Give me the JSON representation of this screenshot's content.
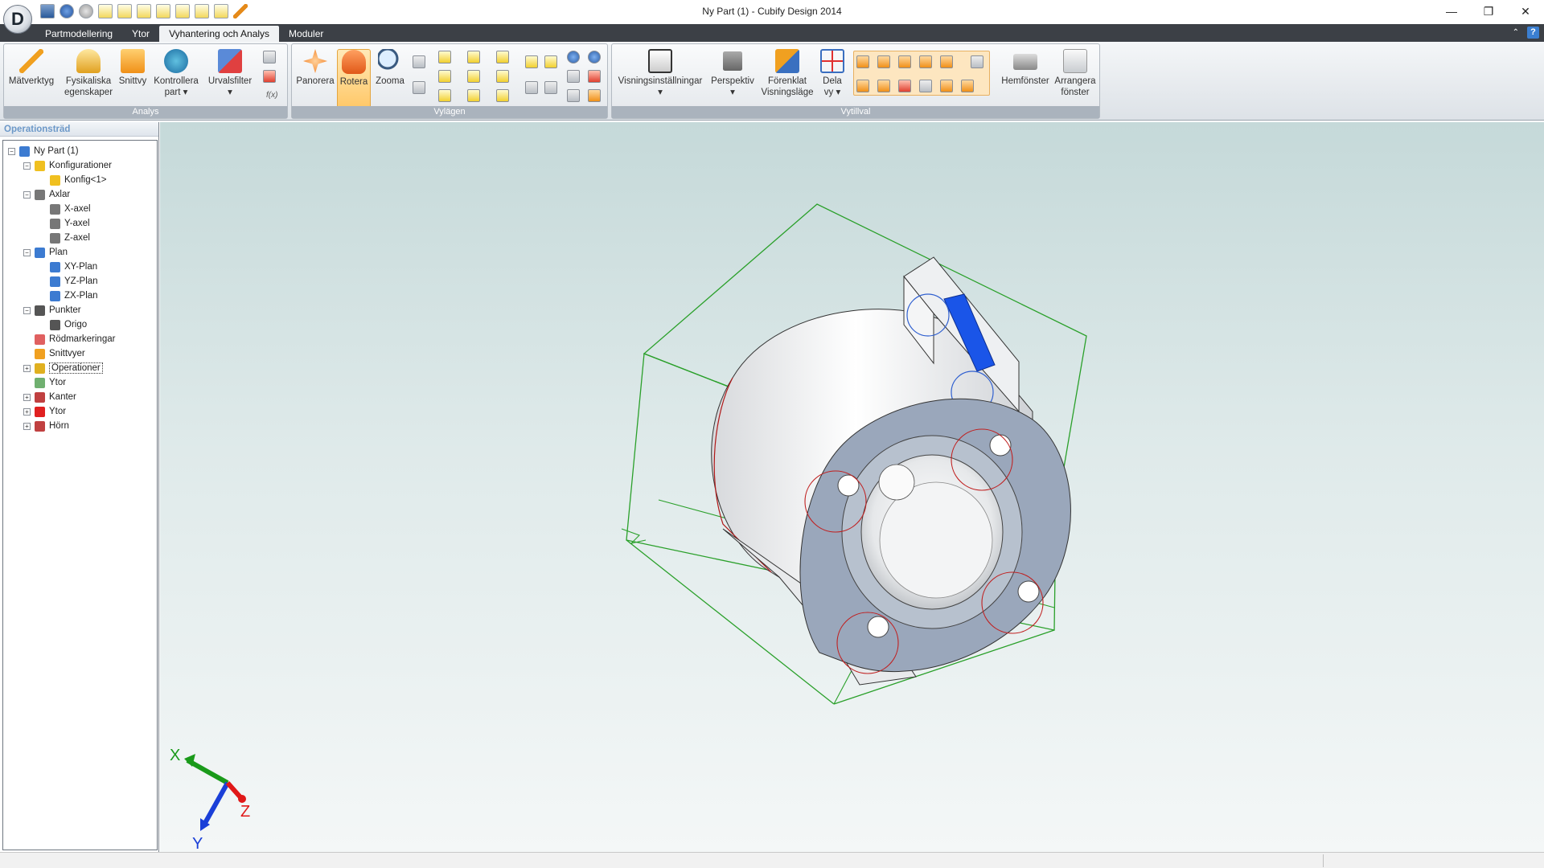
{
  "window": {
    "title": "Ny Part (1) - Cubify Design 2014",
    "logo_letter": "D",
    "minimize": "—",
    "restore": "❐",
    "close": "✕"
  },
  "menu_tabs": [
    "Partmodellering",
    "Ytor",
    "Vyhantering och Analys",
    "Moduler"
  ],
  "active_tab": "Vyhantering och Analys",
  "ribbon": {
    "analys": {
      "label": "Analys",
      "matverktyg": "Mätverktyg",
      "fysikaliska_1": "Fysikaliska",
      "fysikaliska_2": "egenskaper",
      "snittvy": "Snittvy",
      "kontrollera_1": "Kontrollera",
      "kontrollera_2": "part ▾",
      "urvalsfilter": "Urvalsfilter",
      "fx": "f(x)"
    },
    "vylagen": {
      "label": "Vylägen",
      "panorera": "Panorera",
      "rotera": "Rotera",
      "zooma": "Zooma"
    },
    "vytillval": {
      "label": "Vytillval",
      "visning": "Visningsinställningar",
      "perspektiv": "Perspektiv",
      "forenklat_1": "Förenklat",
      "forenklat_2": "Visningsläge",
      "dela_1": "Dela",
      "dela_2": "vy ▾",
      "hemfonster": "Hemfönster",
      "arrangera_1": "Arrangera",
      "arrangera_2": "fönster"
    }
  },
  "sidebar": {
    "title": "Operationsträd",
    "tree": [
      {
        "label": "Ny Part (1)",
        "level": 0,
        "exp": "−",
        "color": "#3c7bd1"
      },
      {
        "label": "Konfigurationer",
        "level": 1,
        "exp": "−",
        "color": "#f0c020"
      },
      {
        "label": "Konfig<1>",
        "level": 2,
        "exp": "",
        "color": "#f0c020"
      },
      {
        "label": "Axlar",
        "level": 1,
        "exp": "−",
        "color": "#777"
      },
      {
        "label": "X-axel",
        "level": 2,
        "exp": "",
        "color": "#777"
      },
      {
        "label": "Y-axel",
        "level": 2,
        "exp": "",
        "color": "#777"
      },
      {
        "label": "Z-axel",
        "level": 2,
        "exp": "",
        "color": "#777"
      },
      {
        "label": "Plan",
        "level": 1,
        "exp": "−",
        "color": "#3c7bd1"
      },
      {
        "label": "XY-Plan",
        "level": 2,
        "exp": "",
        "color": "#3c7bd1"
      },
      {
        "label": "YZ-Plan",
        "level": 2,
        "exp": "",
        "color": "#3c7bd1"
      },
      {
        "label": "ZX-Plan",
        "level": 2,
        "exp": "",
        "color": "#3c7bd1"
      },
      {
        "label": "Punkter",
        "level": 1,
        "exp": "−",
        "color": "#555"
      },
      {
        "label": "Origo",
        "level": 2,
        "exp": "",
        "color": "#555"
      },
      {
        "label": "Rödmarkeringar",
        "level": 1,
        "exp": "",
        "color": "#e06060"
      },
      {
        "label": "Snittvyer",
        "level": 1,
        "exp": "",
        "color": "#f0a020"
      },
      {
        "label": "Operationer",
        "level": 1,
        "exp": "+",
        "color": "#e0b020",
        "boxed": true
      },
      {
        "label": "Ytor",
        "level": 1,
        "exp": "",
        "color": "#70b070"
      },
      {
        "label": "Kanter",
        "level": 1,
        "exp": "+",
        "color": "#c04040"
      },
      {
        "label": "Ytor",
        "level": 1,
        "exp": "+",
        "color": "#e02020"
      },
      {
        "label": "Hörn",
        "level": 1,
        "exp": "+",
        "color": "#c04040"
      }
    ]
  },
  "triad": {
    "x": "X",
    "y": "Y",
    "z": "Z",
    "x_color": "#1a9a1a",
    "y_color": "#1a3fd8",
    "z_color": "#e01818"
  }
}
